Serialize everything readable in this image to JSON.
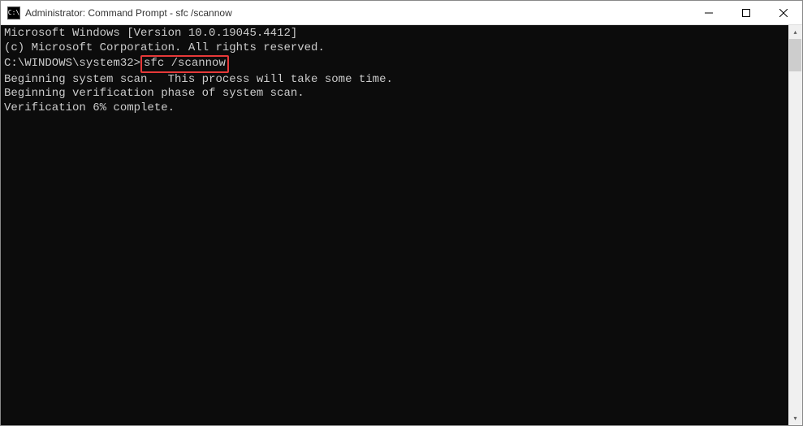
{
  "window": {
    "title": "Administrator: Command Prompt - sfc  /scannow",
    "icon_text": "C:\\"
  },
  "terminal": {
    "line1": "Microsoft Windows [Version 10.0.19045.4412]",
    "line2": "(c) Microsoft Corporation. All rights reserved.",
    "blank1": "",
    "prompt": "C:\\WINDOWS\\system32>",
    "command": "sfc /scannow",
    "blank2": "",
    "line3": "Beginning system scan.  This process will take some time.",
    "blank3": "",
    "line4": "Beginning verification phase of system scan.",
    "line5": "Verification 6% complete."
  }
}
